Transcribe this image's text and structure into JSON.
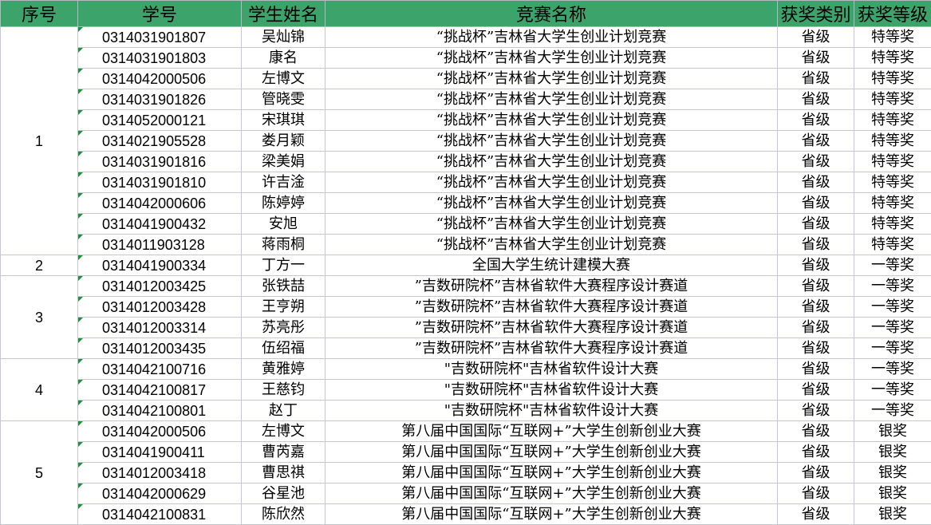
{
  "headers": [
    "序号",
    "学号",
    "学生姓名",
    "竞赛名称",
    "获奖类别",
    "获奖等级"
  ],
  "groups": [
    {
      "seq": "1",
      "rows": [
        {
          "id": "0314031901807",
          "name": "吴灿锦",
          "competition": "“挑战杯”吉林省大学生创业计划竞赛",
          "category": "省级",
          "level": "特等奖"
        },
        {
          "id": "0314031901803",
          "name": "康名",
          "competition": "“挑战杯”吉林省大学生创业计划竞赛",
          "category": "省级",
          "level": "特等奖"
        },
        {
          "id": "0314042000506",
          "name": "左博文",
          "competition": "“挑战杯”吉林省大学生创业计划竞赛",
          "category": "省级",
          "level": "特等奖"
        },
        {
          "id": "0314031901826",
          "name": "管晓雯",
          "competition": "“挑战杯”吉林省大学生创业计划竞赛",
          "category": "省级",
          "level": "特等奖"
        },
        {
          "id": "0314052000121",
          "name": "宋琪琪",
          "competition": "“挑战杯”吉林省大学生创业计划竞赛",
          "category": "省级",
          "level": "特等奖"
        },
        {
          "id": "0314021905528",
          "name": "娄月颖",
          "competition": "“挑战杯”吉林省大学生创业计划竞赛",
          "category": "省级",
          "level": "特等奖"
        },
        {
          "id": "0314031901816",
          "name": "梁美娟",
          "competition": "“挑战杯”吉林省大学生创业计划竞赛",
          "category": "省级",
          "level": "特等奖"
        },
        {
          "id": "0314031901810",
          "name": "许吉淦",
          "competition": "“挑战杯”吉林省大学生创业计划竞赛",
          "category": "省级",
          "level": "特等奖"
        },
        {
          "id": "0314042000606",
          "name": "陈婷婷",
          "competition": "“挑战杯”吉林省大学生创业计划竞赛",
          "category": "省级",
          "level": "特等奖"
        },
        {
          "id": "0314041900432",
          "name": "安旭",
          "competition": "“挑战杯”吉林省大学生创业计划竞赛",
          "category": "省级",
          "level": "特等奖"
        },
        {
          "id": "0314011903128",
          "name": "蒋雨桐",
          "competition": "“挑战杯”吉林省大学生创业计划竞赛",
          "category": "省级",
          "level": "特等奖"
        }
      ]
    },
    {
      "seq": "2",
      "rows": [
        {
          "id": "0314041900334",
          "name": "丁方一",
          "competition": "全国大学生统计建模大赛",
          "category": "省级",
          "level": "一等奖"
        }
      ]
    },
    {
      "seq": "3",
      "rows": [
        {
          "id": "0314012003425",
          "name": "张铁喆",
          "competition": "”吉数研院杯”吉林省软件大赛程序设计赛道",
          "category": "省级",
          "level": "一等奖"
        },
        {
          "id": "0314012003428",
          "name": "王亨朔",
          "competition": "”吉数研院杯”吉林省软件大赛程序设计赛道",
          "category": "省级",
          "level": "一等奖"
        },
        {
          "id": "0314012003314",
          "name": "苏亮彤",
          "competition": "”吉数研院杯”吉林省软件大赛程序设计赛道",
          "category": "省级",
          "level": "一等奖"
        },
        {
          "id": "0314012003435",
          "name": "伍绍福",
          "competition": "”吉数研院杯”吉林省软件大赛程序设计赛道",
          "category": "省级",
          "level": "一等奖"
        }
      ]
    },
    {
      "seq": "4",
      "rows": [
        {
          "id": "0314042100716",
          "name": "黄雅婷",
          "competition": "\"吉数研院杯\"吉林省软件设计大赛",
          "category": "省级",
          "level": "一等奖"
        },
        {
          "id": "0314042100817",
          "name": "王慈钧",
          "competition": "\"吉数研院杯\"吉林省软件设计大赛",
          "category": "省级",
          "level": "一等奖"
        },
        {
          "id": "0314042100801",
          "name": "赵丁",
          "competition": "\"吉数研院杯\"吉林省软件设计大赛",
          "category": "省级",
          "level": "一等奖"
        }
      ]
    },
    {
      "seq": "5",
      "rows": [
        {
          "id": "0314042000506",
          "name": "左博文",
          "competition": "第八届中国国际“互联网+”大学生创新创业大赛",
          "category": "省级",
          "level": "银奖"
        },
        {
          "id": "0314041900411",
          "name": "曹芮嘉",
          "competition": "第八届中国国际“互联网+”大学生创新创业大赛",
          "category": "省级",
          "level": "银奖"
        },
        {
          "id": "0314012003418",
          "name": "曹思祺",
          "competition": "第八届中国国际“互联网+”大学生创新创业大赛",
          "category": "省级",
          "level": "银奖"
        },
        {
          "id": "0314042000629",
          "name": "谷星池",
          "competition": "第八届中国国际“互联网+”大学生创新创业大赛",
          "category": "省级",
          "level": "银奖"
        },
        {
          "id": "0314042100831",
          "name": "陈欣然",
          "competition": "第八届中国国际“互联网+”大学生创新创业大赛",
          "category": "省级",
          "level": "银奖"
        }
      ]
    }
  ],
  "colors": {
    "header_bg": "#3ca36a",
    "grid": "#c6c6d6",
    "cell_marker": "#1f8f3c"
  }
}
